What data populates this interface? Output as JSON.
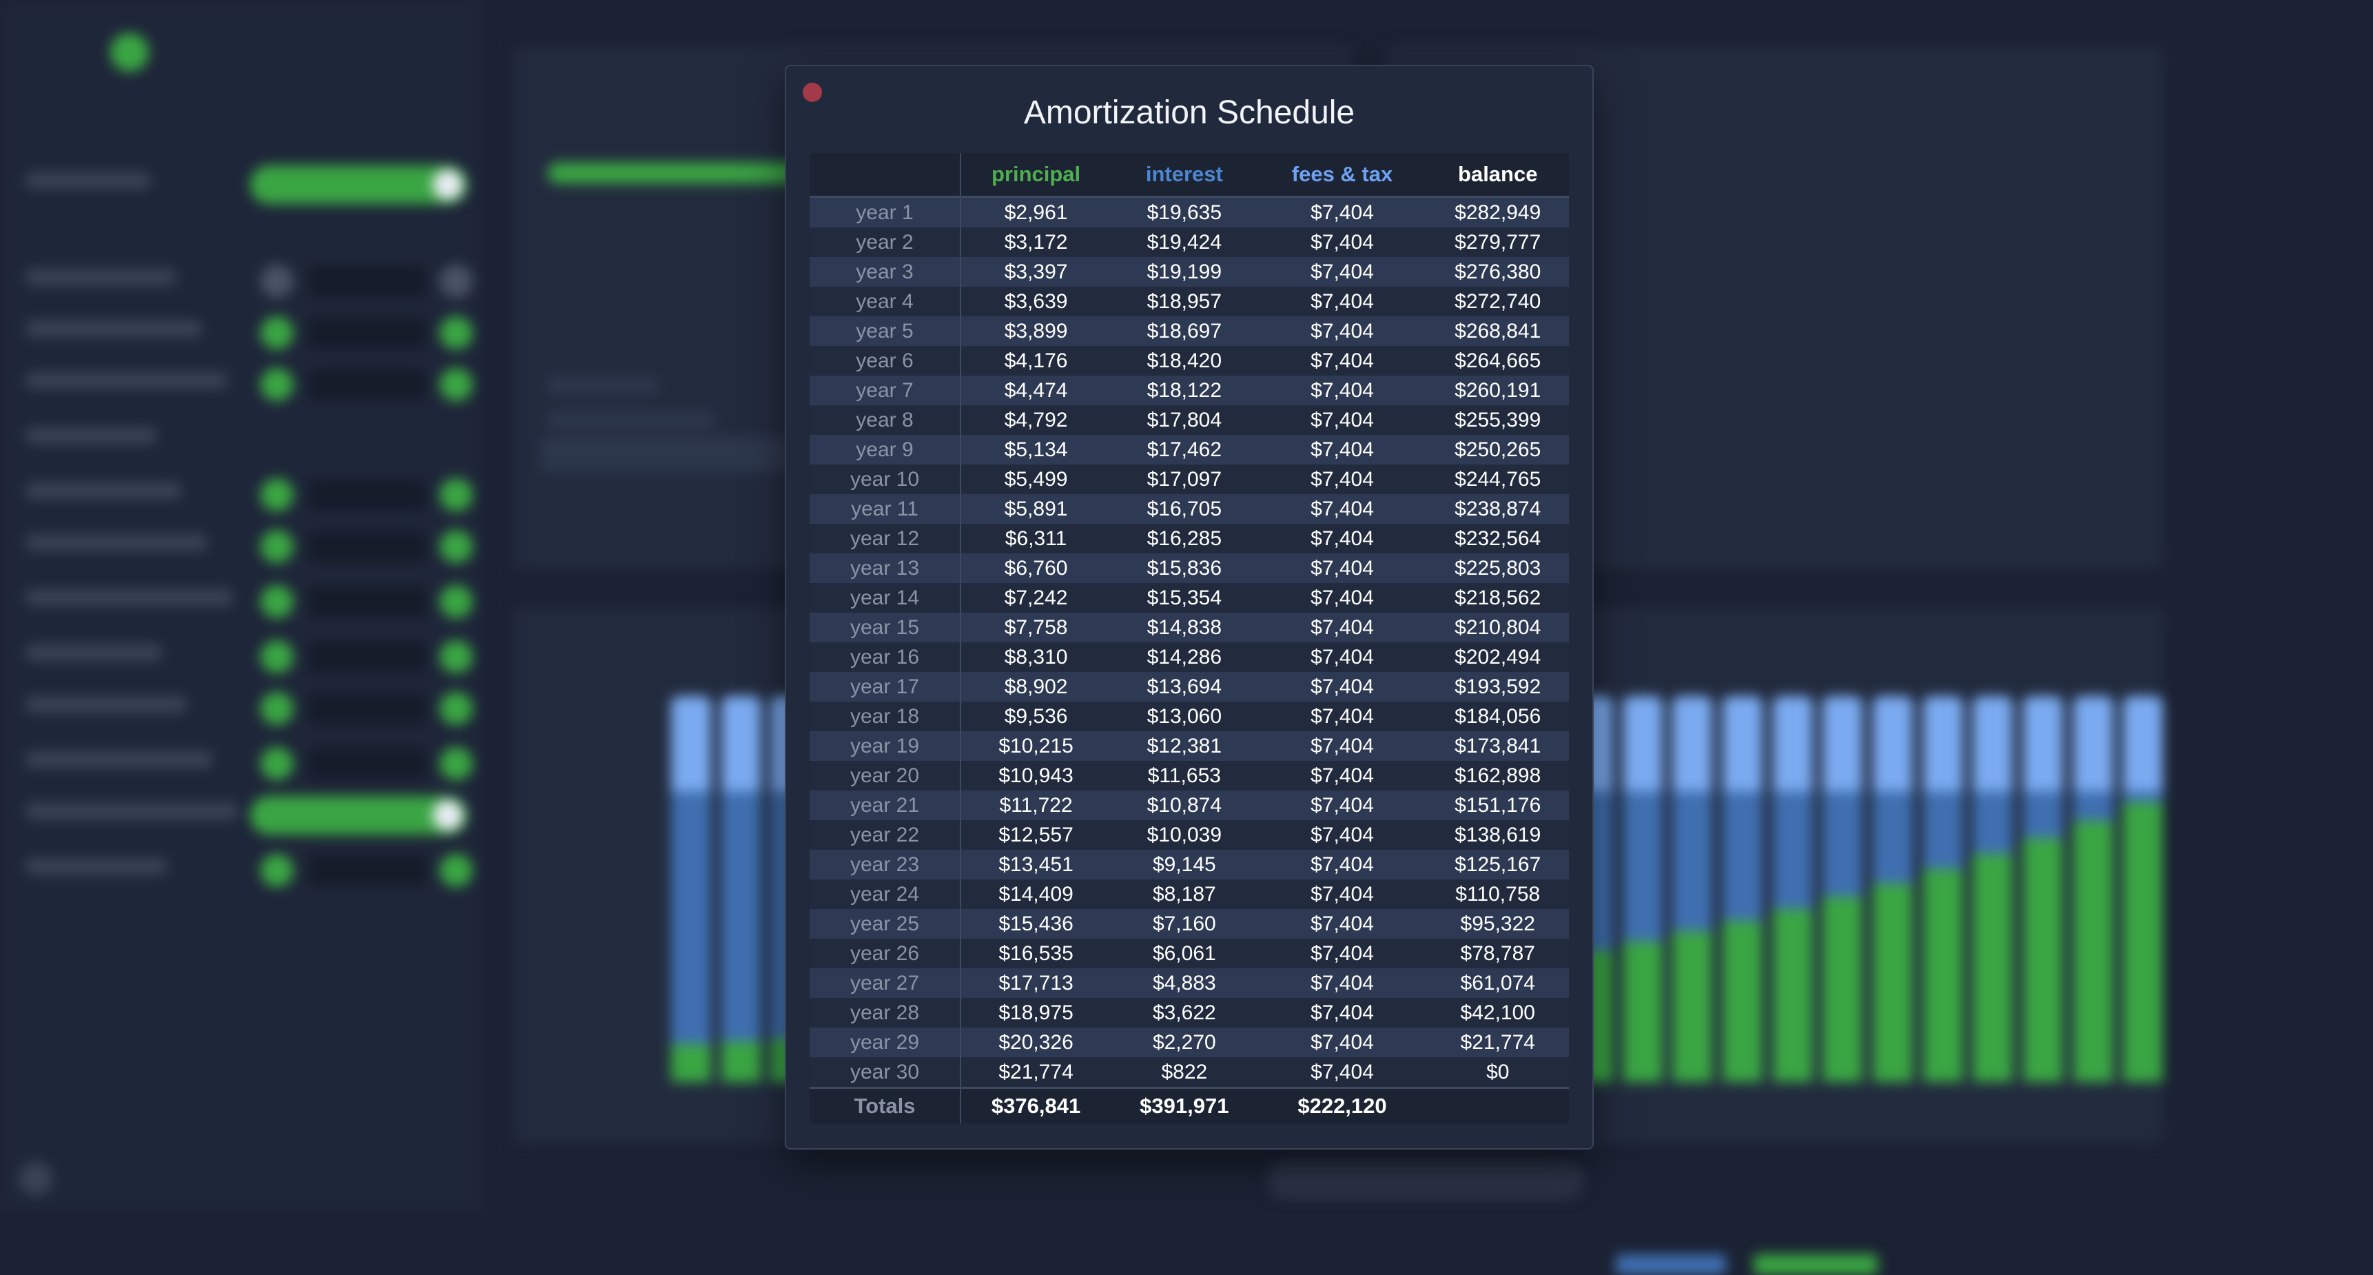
{
  "modal": {
    "title": "Amortization Schedule",
    "columns": {
      "principal": "principal",
      "interest": "interest",
      "fees": "fees & tax",
      "balance": "balance"
    },
    "rows": [
      {
        "year": "year 1",
        "principal": "$2,961",
        "interest": "$19,635",
        "fees": "$7,404",
        "balance": "$282,949"
      },
      {
        "year": "year 2",
        "principal": "$3,172",
        "interest": "$19,424",
        "fees": "$7,404",
        "balance": "$279,777"
      },
      {
        "year": "year 3",
        "principal": "$3,397",
        "interest": "$19,199",
        "fees": "$7,404",
        "balance": "$276,380"
      },
      {
        "year": "year 4",
        "principal": "$3,639",
        "interest": "$18,957",
        "fees": "$7,404",
        "balance": "$272,740"
      },
      {
        "year": "year 5",
        "principal": "$3,899",
        "interest": "$18,697",
        "fees": "$7,404",
        "balance": "$268,841"
      },
      {
        "year": "year 6",
        "principal": "$4,176",
        "interest": "$18,420",
        "fees": "$7,404",
        "balance": "$264,665"
      },
      {
        "year": "year 7",
        "principal": "$4,474",
        "interest": "$18,122",
        "fees": "$7,404",
        "balance": "$260,191"
      },
      {
        "year": "year 8",
        "principal": "$4,792",
        "interest": "$17,804",
        "fees": "$7,404",
        "balance": "$255,399"
      },
      {
        "year": "year 9",
        "principal": "$5,134",
        "interest": "$17,462",
        "fees": "$7,404",
        "balance": "$250,265"
      },
      {
        "year": "year 10",
        "principal": "$5,499",
        "interest": "$17,097",
        "fees": "$7,404",
        "balance": "$244,765"
      },
      {
        "year": "year 11",
        "principal": "$5,891",
        "interest": "$16,705",
        "fees": "$7,404",
        "balance": "$238,874"
      },
      {
        "year": "year 12",
        "principal": "$6,311",
        "interest": "$16,285",
        "fees": "$7,404",
        "balance": "$232,564"
      },
      {
        "year": "year 13",
        "principal": "$6,760",
        "interest": "$15,836",
        "fees": "$7,404",
        "balance": "$225,803"
      },
      {
        "year": "year 14",
        "principal": "$7,242",
        "interest": "$15,354",
        "fees": "$7,404",
        "balance": "$218,562"
      },
      {
        "year": "year 15",
        "principal": "$7,758",
        "interest": "$14,838",
        "fees": "$7,404",
        "balance": "$210,804"
      },
      {
        "year": "year 16",
        "principal": "$8,310",
        "interest": "$14,286",
        "fees": "$7,404",
        "balance": "$202,494"
      },
      {
        "year": "year 17",
        "principal": "$8,902",
        "interest": "$13,694",
        "fees": "$7,404",
        "balance": "$193,592"
      },
      {
        "year": "year 18",
        "principal": "$9,536",
        "interest": "$13,060",
        "fees": "$7,404",
        "balance": "$184,056"
      },
      {
        "year": "year 19",
        "principal": "$10,215",
        "interest": "$12,381",
        "fees": "$7,404",
        "balance": "$173,841"
      },
      {
        "year": "year 20",
        "principal": "$10,943",
        "interest": "$11,653",
        "fees": "$7,404",
        "balance": "$162,898"
      },
      {
        "year": "year 21",
        "principal": "$11,722",
        "interest": "$10,874",
        "fees": "$7,404",
        "balance": "$151,176"
      },
      {
        "year": "year 22",
        "principal": "$12,557",
        "interest": "$10,039",
        "fees": "$7,404",
        "balance": "$138,619"
      },
      {
        "year": "year 23",
        "principal": "$13,451",
        "interest": "$9,145",
        "fees": "$7,404",
        "balance": "$125,167"
      },
      {
        "year": "year 24",
        "principal": "$14,409",
        "interest": "$8,187",
        "fees": "$7,404",
        "balance": "$110,758"
      },
      {
        "year": "year 25",
        "principal": "$15,436",
        "interest": "$7,160",
        "fees": "$7,404",
        "balance": "$95,322"
      },
      {
        "year": "year 26",
        "principal": "$16,535",
        "interest": "$6,061",
        "fees": "$7,404",
        "balance": "$78,787"
      },
      {
        "year": "year 27",
        "principal": "$17,713",
        "interest": "$4,883",
        "fees": "$7,404",
        "balance": "$61,074"
      },
      {
        "year": "year 28",
        "principal": "$18,975",
        "interest": "$3,622",
        "fees": "$7,404",
        "balance": "$42,100"
      },
      {
        "year": "year 29",
        "principal": "$20,326",
        "interest": "$2,270",
        "fees": "$7,404",
        "balance": "$21,774"
      },
      {
        "year": "year 30",
        "principal": "$21,774",
        "interest": "$822",
        "fees": "$7,404",
        "balance": "$0"
      }
    ],
    "totals": {
      "label": "Totals",
      "principal": "$376,841",
      "interest": "$391,971",
      "fees": "$222,120",
      "balance": ""
    }
  },
  "colors": {
    "principal": "#4fae4f",
    "interest": "#4d86d1",
    "fees": "#6fa2f2",
    "close": "#a33a4a",
    "accent_green": "#3aa543"
  },
  "icons": {
    "close": "close-icon",
    "logo": "logo-icon",
    "settings": "gear-icon"
  }
}
